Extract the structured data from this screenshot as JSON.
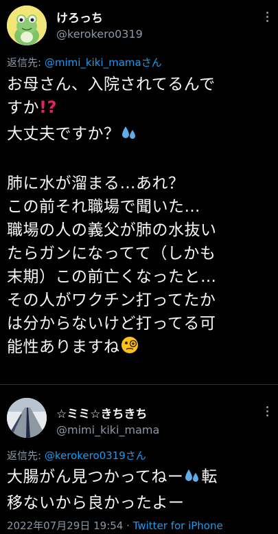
{
  "tweet_main": {
    "display_name": "けろっち",
    "handle": "@kerokero0319",
    "reply_prefix": "返信先: ",
    "reply_mention": "@mimi_kiki_mamaさん",
    "text_lines": [
      "お母さん、入院されてるんで",
      "すか",
      "大丈夫ですか？",
      "",
      "肺に水が溜まる…あれ？",
      "この前それ職場で聞いた…",
      "職場の人の義父が肺の水抜い",
      "たらガンになってて（しかも",
      "末期）この前亡くなったと…",
      "その人がワクチン打ってたか",
      "は分からないけど打ってる可",
      "能性ありますね"
    ],
    "emojis": [
      "exclamation-question-icon",
      "sweat-drops-icon",
      "monocle-face-icon"
    ]
  },
  "tweet_reply": {
    "display_name": "☆ミミ☆きちきち",
    "handle": "@mimi_kiki_mama",
    "reply_prefix": "返信先: ",
    "reply_mention": "@kerokero0319さん",
    "text_lines": [
      "大腸がん見つかってねー",
      "転",
      "移ないから良かったよー"
    ],
    "timestamp": "2022年07月29日 19:54",
    "separator": " · ",
    "source": "Twitter for iPhone"
  },
  "colors": {
    "background": "#000000",
    "text": "#f7f9f9",
    "secondary": "#8b98a5",
    "link": "#1d9bf0",
    "divider": "#2f3336"
  }
}
